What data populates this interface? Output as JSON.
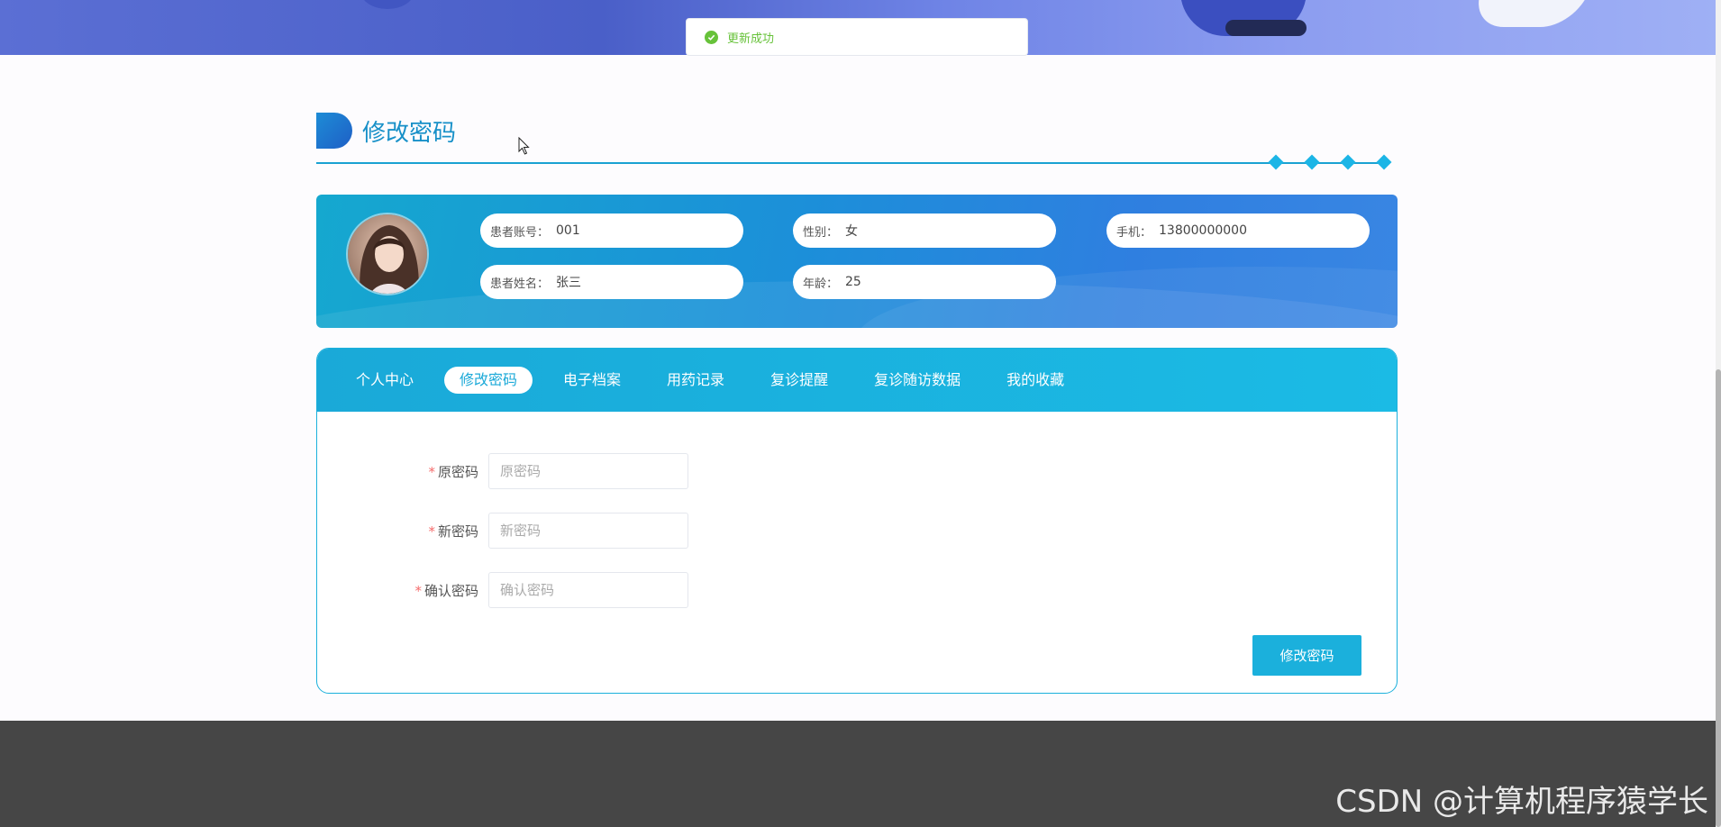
{
  "toast": {
    "message": "更新成功"
  },
  "section": {
    "title": "修改密码"
  },
  "profile": {
    "account_label": "患者账号：",
    "account_value": "001",
    "gender_label": "性别：",
    "gender_value": "女",
    "phone_label": "手机：",
    "phone_value": "13800000000",
    "name_label": "患者姓名：",
    "name_value": "张三",
    "age_label": "年龄：",
    "age_value": "25"
  },
  "tabs": [
    {
      "label": "个人中心",
      "active": false
    },
    {
      "label": "修改密码",
      "active": true
    },
    {
      "label": "电子档案",
      "active": false
    },
    {
      "label": "用药记录",
      "active": false
    },
    {
      "label": "复诊提醒",
      "active": false
    },
    {
      "label": "复诊随访数据",
      "active": false
    },
    {
      "label": "我的收藏",
      "active": false
    }
  ],
  "form": {
    "required_mark": "*",
    "old_password": {
      "label": "原密码",
      "placeholder": "原密码"
    },
    "new_password": {
      "label": "新密码",
      "placeholder": "新密码"
    },
    "confirm_password": {
      "label": "确认密码",
      "placeholder": "确认密码"
    },
    "submit_label": "修改密码"
  },
  "watermark": "CSDN @计算机程序猿学长",
  "colors": {
    "accent": "#1bb0dc",
    "success": "#67c23a",
    "required": "#f56c6c",
    "footer": "#464646"
  }
}
